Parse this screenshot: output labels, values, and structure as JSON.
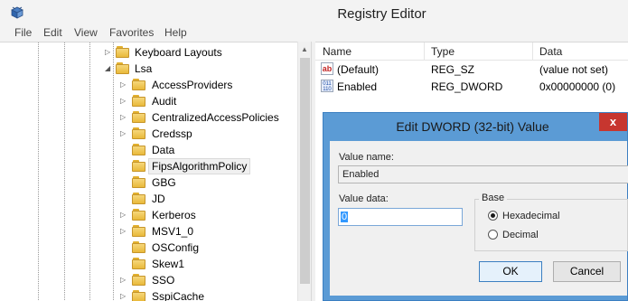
{
  "window": {
    "title": "Registry Editor",
    "app_icon": "registry-cube-icon"
  },
  "menu": [
    "File",
    "Edit",
    "View",
    "Favorites",
    "Help"
  ],
  "tree": {
    "items": [
      {
        "label": "Keyboard Layouts",
        "expander": "▷"
      },
      {
        "label": "Lsa",
        "expander": "◢"
      },
      {
        "label": "AccessProviders",
        "expander": "▷"
      },
      {
        "label": "Audit",
        "expander": "▷"
      },
      {
        "label": "CentralizedAccessPolicies",
        "expander": "▷"
      },
      {
        "label": "Credssp",
        "expander": "▷"
      },
      {
        "label": "Data",
        "expander": ""
      },
      {
        "label": "FipsAlgorithmPolicy",
        "expander": "",
        "selected": true
      },
      {
        "label": "GBG",
        "expander": ""
      },
      {
        "label": "JD",
        "expander": ""
      },
      {
        "label": "Kerberos",
        "expander": "▷"
      },
      {
        "label": "MSV1_0",
        "expander": "▷"
      },
      {
        "label": "OSConfig",
        "expander": ""
      },
      {
        "label": "Skew1",
        "expander": ""
      },
      {
        "label": "SSO",
        "expander": "▷"
      },
      {
        "label": "SspiCache",
        "expander": "▷"
      }
    ]
  },
  "list": {
    "columns": [
      "Name",
      "Type",
      "Data"
    ],
    "rows": [
      {
        "icon": "string-value-icon",
        "name": "(Default)",
        "type": "REG_SZ",
        "data": "(value not set)"
      },
      {
        "icon": "binary-value-icon",
        "name": "Enabled",
        "type": "REG_DWORD",
        "data": "0x00000000 (0)"
      }
    ]
  },
  "dialog": {
    "title": "Edit DWORD (32-bit) Value",
    "close_label": "x",
    "value_name_label": "Value name:",
    "value_name": "Enabled",
    "value_data_label": "Value data:",
    "value_data": "0",
    "base_label": "Base",
    "base_options": [
      {
        "label": "Hexadecimal",
        "checked": true
      },
      {
        "label": "Decimal",
        "checked": false
      }
    ],
    "ok_label": "OK",
    "cancel_label": "Cancel"
  },
  "colors": {
    "dialog_frame": "#5b9bd5",
    "close_button": "#c7362f",
    "selection": "#3399ff"
  }
}
